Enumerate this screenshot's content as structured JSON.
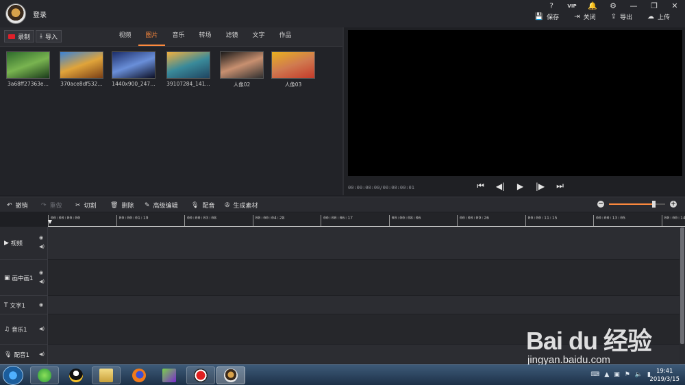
{
  "app": {
    "login_label": "登录",
    "window_controls": [
      "?",
      "VIP",
      "bell-icon",
      "gear-icon",
      "minimize-icon",
      "restore-icon",
      "close-icon"
    ]
  },
  "actions": {
    "save": "保存",
    "close": "关闭",
    "export": "导出",
    "upload": "上传"
  },
  "library_toolbar": {
    "record": "录制",
    "import": "导入",
    "tabs": [
      "视频",
      "图片",
      "音乐",
      "转场",
      "滤镜",
      "文字",
      "作品"
    ],
    "active_tab": "图片"
  },
  "library": {
    "items": [
      {
        "caption": "3a68ff27363e…",
        "colors": [
          "#2f6b2c",
          "#79b450",
          "#1a3a1a"
        ]
      },
      {
        "caption": "370ace8df532…",
        "colors": [
          "#3a82d6",
          "#e0a43a",
          "#7a3f16"
        ]
      },
      {
        "caption": "1440x900_247…",
        "colors": [
          "#1c2e6a",
          "#6a8fd9",
          "#0c0f25"
        ]
      },
      {
        "caption": "39107284_141…",
        "colors": [
          "#f0b040",
          "#3a8a9a",
          "#1f4460"
        ]
      },
      {
        "caption": "人像02",
        "colors": [
          "#1a1a1a",
          "#c89070",
          "#303030"
        ]
      },
      {
        "caption": "人像03",
        "colors": [
          "#e8b020",
          "#d07a50",
          "#c43a2a"
        ]
      }
    ]
  },
  "preview": {
    "timecode": "00:00:00:00/00:00:00:01",
    "controls": [
      "skip-start-icon",
      "prev-frame-icon",
      "play-icon",
      "next-frame-icon",
      "skip-end-icon"
    ]
  },
  "edit_toolbar": {
    "undo": "撤销",
    "redo": "重做",
    "cut": "切割",
    "delete": "删除",
    "advanced_edit": "高级编辑",
    "dub": "配音",
    "generate": "生成素材",
    "zoom_level": 0.8
  },
  "ruler": {
    "ticks": [
      "00:00:00:00",
      "00:00:01:19",
      "00:00:03:08",
      "00:00:04:28",
      "00:00:06:17",
      "00:00:08:06",
      "00:00:09:26",
      "00:00:11:15",
      "00:00:13:05",
      "00:00:14:"
    ]
  },
  "tracks": [
    {
      "name": "视频",
      "icon": "play-square-icon",
      "eye": true,
      "volume": true
    },
    {
      "name": "画中画1",
      "icon": "pip-icon",
      "eye": true,
      "volume": true
    },
    {
      "name": "文字1",
      "icon": "text-icon",
      "eye": true,
      "volume": false
    },
    {
      "name": "音乐1",
      "icon": "music-icon",
      "eye": false,
      "volume": true
    },
    {
      "name": "配音1",
      "icon": "mic-icon",
      "eye": false,
      "volume": true
    }
  ],
  "taskbar": {
    "clock_time": "19:41",
    "clock_date": "2019/3/15"
  },
  "watermark": {
    "brand": "Bai du 经验",
    "url": "jingyan.baidu.com"
  }
}
